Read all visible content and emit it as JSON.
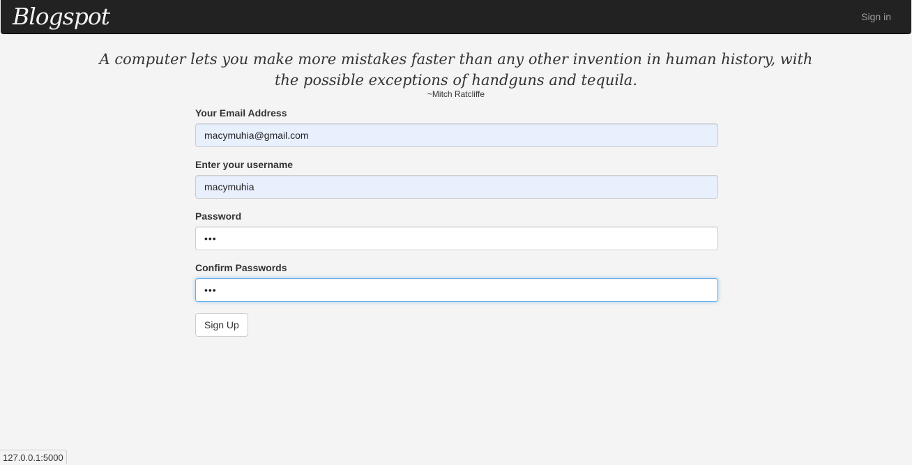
{
  "navbar": {
    "brand": "Blogspot",
    "signin_label": "Sign in"
  },
  "quote": {
    "text": "A computer lets you make more mistakes faster than any other invention in human history, with the possible exceptions of handguns and tequila.",
    "author": "~Mitch Ratcliffe"
  },
  "form": {
    "email": {
      "label": "Your Email Address",
      "value": "macymuhia@gmail.com"
    },
    "username": {
      "label": "Enter your username",
      "value": "macymuhia"
    },
    "password": {
      "label": "Password",
      "value": "abc"
    },
    "confirm_password": {
      "label": "Confirm Passwords",
      "value": "abc"
    },
    "submit_label": "Sign Up"
  },
  "statusbar": {
    "url": "127.0.0.1:5000"
  },
  "colors": {
    "navbar_bg": "#222222",
    "page_bg": "#f4f4f4",
    "autofill_bg": "#e8f0fe",
    "focus_border": "#66afe9"
  }
}
